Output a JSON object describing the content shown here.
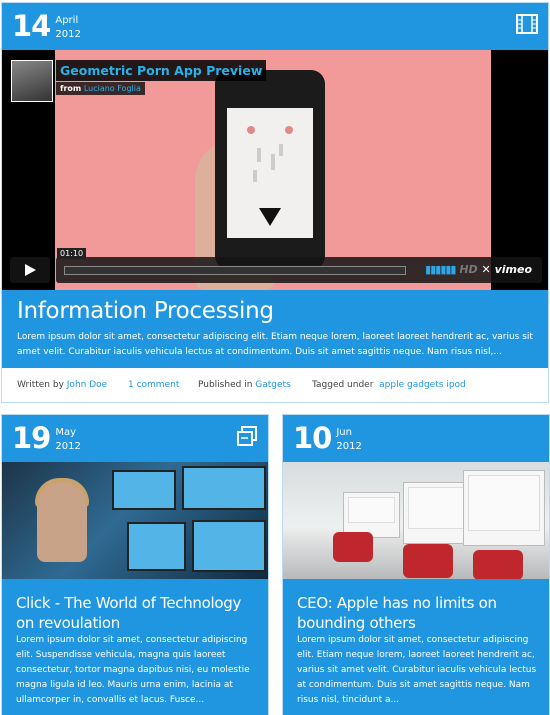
{
  "posts": [
    {
      "day": "14",
      "month": "April",
      "year": "2012",
      "type_icon": "film-icon",
      "video": {
        "title": "Geometric Porn App Preview",
        "from_label": "from",
        "author": "Luciano Foglia",
        "time": "01:10",
        "hd": "HD",
        "brand": "vimeo"
      },
      "title": "Information Processing",
      "excerpt": "Lorem ipsum dolor sit amet, consectetur adipiscing elit. Etiam neque lorem, laoreet laoreet hendrerit ac, varius sit amet velit. Curabitur iaculis vehicula lectus at condimentum. Duis sit amet sagittis neque. Nam risus nisl,...",
      "meta": {
        "written_by": "Written by",
        "author": "John Doe",
        "comments": "1 comment",
        "published_in": "Published in",
        "category": "Gatgets",
        "tagged_under": "Tagged under",
        "tags": [
          "apple",
          "gadgets",
          "ipod"
        ]
      }
    },
    {
      "day": "19",
      "month": "May",
      "year": "2012",
      "type_icon": "gallery-icon",
      "title": "Click - The World of Technology on revoulation",
      "excerpt": "Lorem ipsum dolor sit amet, consectetur adipiscing elit. Suspendisse vehicula, magna quis laoreet consectetur, tortor magna dapibus nisi, eu molestie magna ligula id leo. Mauris urna enim, lacinia at ullamcorper in, convallis et lacus. Fusce..."
    },
    {
      "day": "10",
      "month": "Jun",
      "year": "2012",
      "type_icon": "",
      "title": "CEO: Apple has no limits on bounding others",
      "excerpt": "Lorem ipsum dolor sit amet, consectetur adipiscing elit. Etiam neque lorem, laoreet laoreet hendrerit ac, varius sit amet velit. Curabitur iaculis vehicula lectus at condimentum. Duis sit amet sagittis neque. Nam risus nisl, tincidunt a..."
    }
  ],
  "colors": {
    "accent": "#2196e0",
    "link": "#2196e0",
    "video_title": "#26b3ea",
    "video_bg": "#f19a99"
  }
}
